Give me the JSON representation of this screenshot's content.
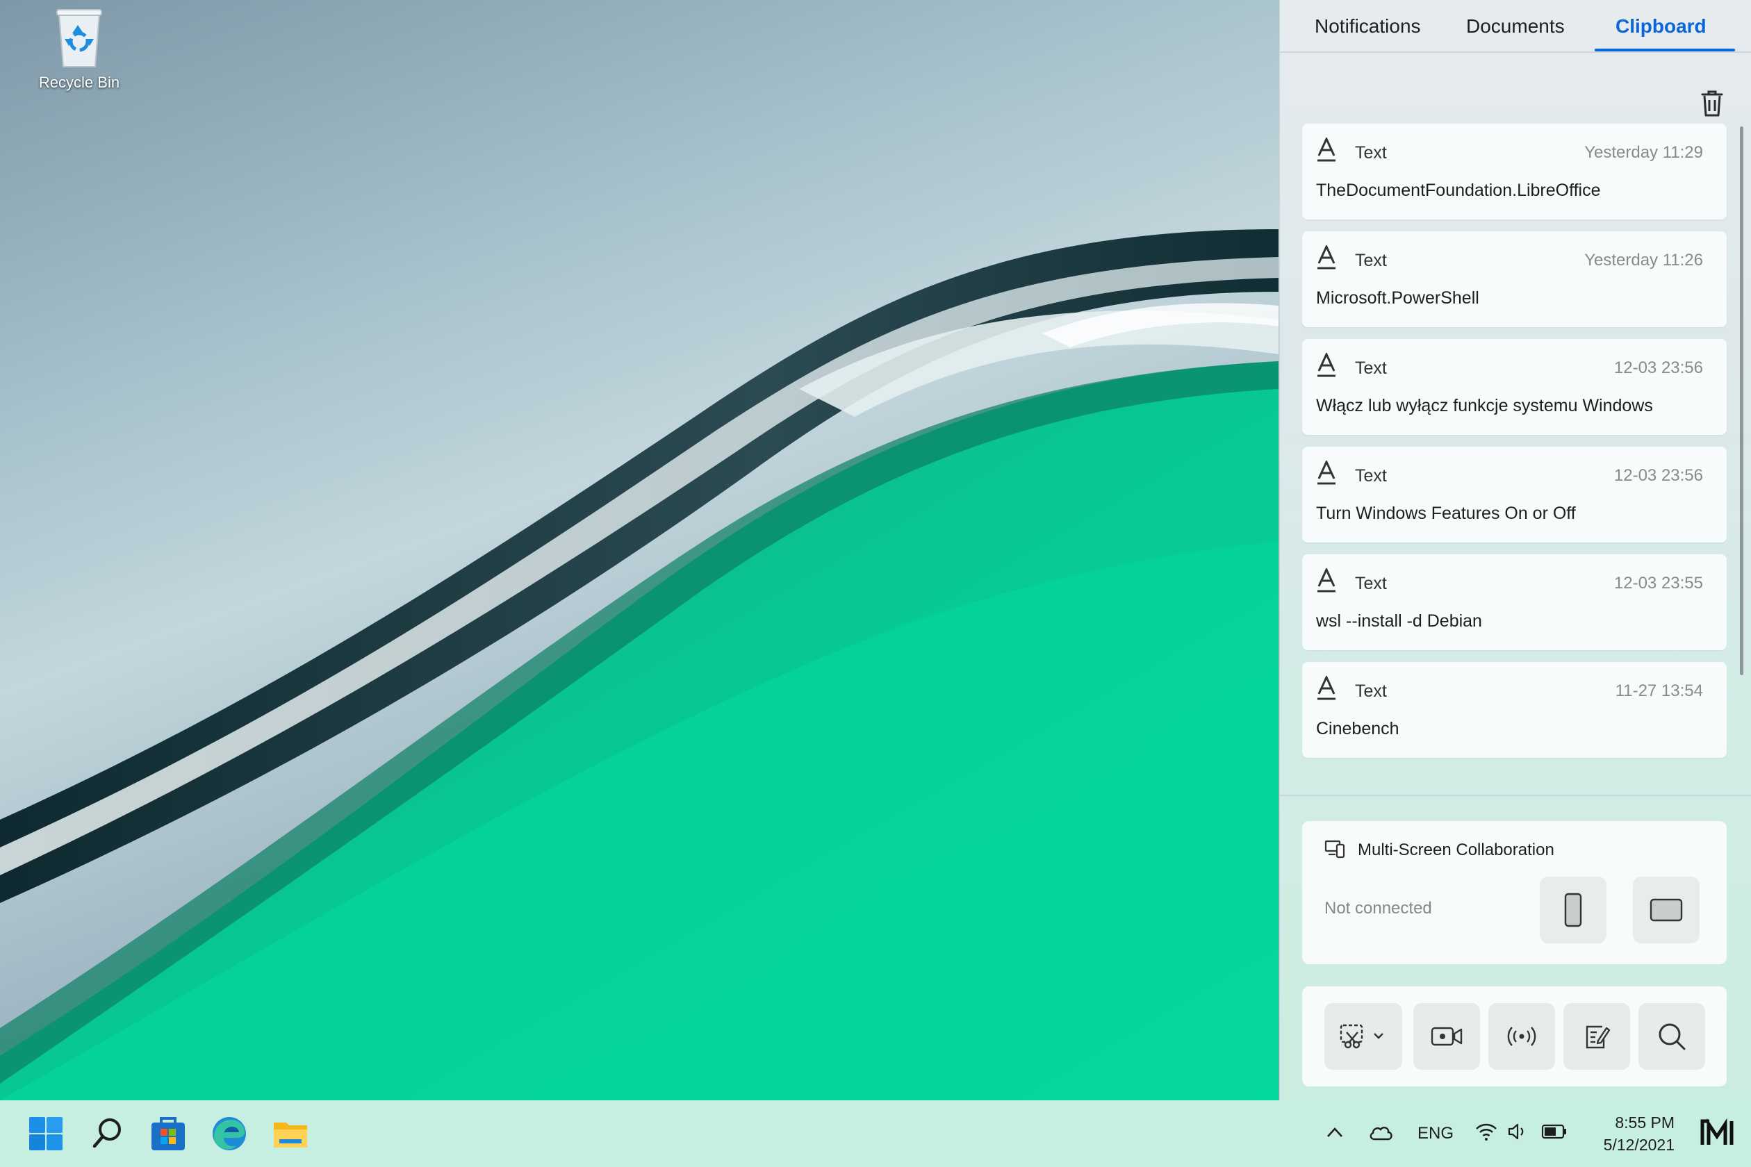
{
  "desktop": {
    "icons": [
      {
        "label": "Recycle Bin",
        "icon": "recycle-bin-icon"
      }
    ]
  },
  "panel": {
    "tabs": [
      {
        "label": "Notifications",
        "active": false
      },
      {
        "label": "Documents",
        "active": false
      },
      {
        "label": "Clipboard",
        "active": true
      }
    ],
    "clear_icon": "trash-icon",
    "clipboard_items": [
      {
        "kind": "Text",
        "time": "Yesterday 11:29",
        "content": "TheDocumentFoundation.LibreOffice"
      },
      {
        "kind": "Text",
        "time": "Yesterday 11:26",
        "content": "Microsoft.PowerShell"
      },
      {
        "kind": "Text",
        "time": "12-03 23:56",
        "content": "Włącz lub wyłącz funkcje systemu Windows"
      },
      {
        "kind": "Text",
        "time": "12-03 23:56",
        "content": "Turn Windows Features On or Off"
      },
      {
        "kind": "Text",
        "time": "12-03 23:55",
        "content": "wsl --install -d Debian"
      },
      {
        "kind": "Text",
        "time": "11-27 13:54",
        "content": "Cinebench"
      }
    ],
    "multi_screen": {
      "title": "Multi-Screen Collaboration",
      "status": "Not connected",
      "devices": [
        "phone-icon",
        "tablet-icon"
      ]
    },
    "tools": [
      "screenshot-icon",
      "screen-record-icon",
      "wireless-projection-icon",
      "notes-icon",
      "search-icon"
    ]
  },
  "taskbar": {
    "apps": [
      "start-icon",
      "search-icon",
      "store-icon",
      "edge-icon",
      "file-explorer-icon"
    ],
    "tray": {
      "language": "ENG",
      "time": "8:55 PM",
      "date": "5/12/2021"
    },
    "accent": "#0a66d8"
  }
}
